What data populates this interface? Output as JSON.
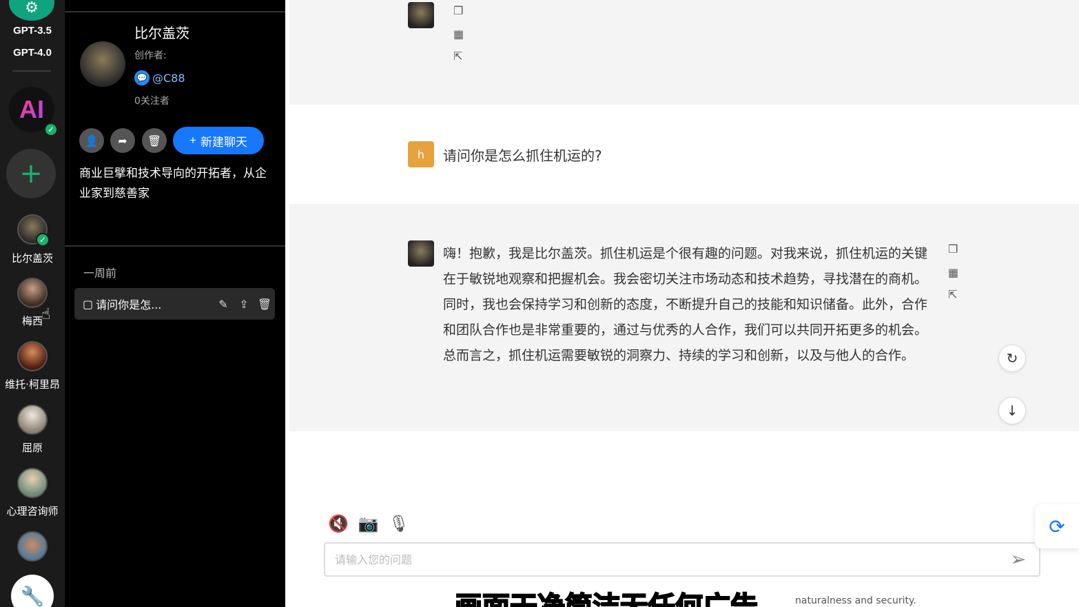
{
  "rail": {
    "models": [
      "GPT-3.5",
      "GPT-4.0"
    ],
    "ai_badge": "AI",
    "bots": [
      {
        "label": "比尔盖茨"
      },
      {
        "label": "梅西"
      },
      {
        "label": "维托·柯里昂"
      },
      {
        "label": "屈原"
      },
      {
        "label": "心理咨询师"
      }
    ]
  },
  "panel": {
    "bot_name": "比尔盖茨",
    "creator_label": "创作者:",
    "creator_handle": "@C88",
    "followers": "0关注者",
    "new_chat_label": "新建聊天",
    "description": "商业巨擘和技术导向的开拓者，从企业家到慈善家",
    "section_label": "一周前",
    "conversations": [
      {
        "label": "请问你是怎..."
      }
    ]
  },
  "chat": {
    "user_initial": "h",
    "question": "请问你是怎么抓住机运的?",
    "answer": "嗨！抱歉，我是比尔盖茨。抓住机运是个很有趣的问题。对我来说，抓住机运的关键在于敏锐地观察和把握机会。我会密切关注市场动态和技术趋势，寻找潜在的商机。同时，我也会保持学习和创新的态度，不断提升自己的技能和知识储备。此外，合作和团队合作也是非常重要的，通过与优秀的人合作，我们可以共同开拓更多的机会。总而言之，抓住机运需要敏锐的洞察力、持续的学习和创新，以及与他人的合作。",
    "input_placeholder": "请输入您的问题",
    "footer_text": "naturalness and security.",
    "subtitle": "画面干净简洁无任何广告"
  },
  "colors": {
    "accent": "#1677ff",
    "success": "#19b26b",
    "user_avatar": "#e6a23c"
  }
}
